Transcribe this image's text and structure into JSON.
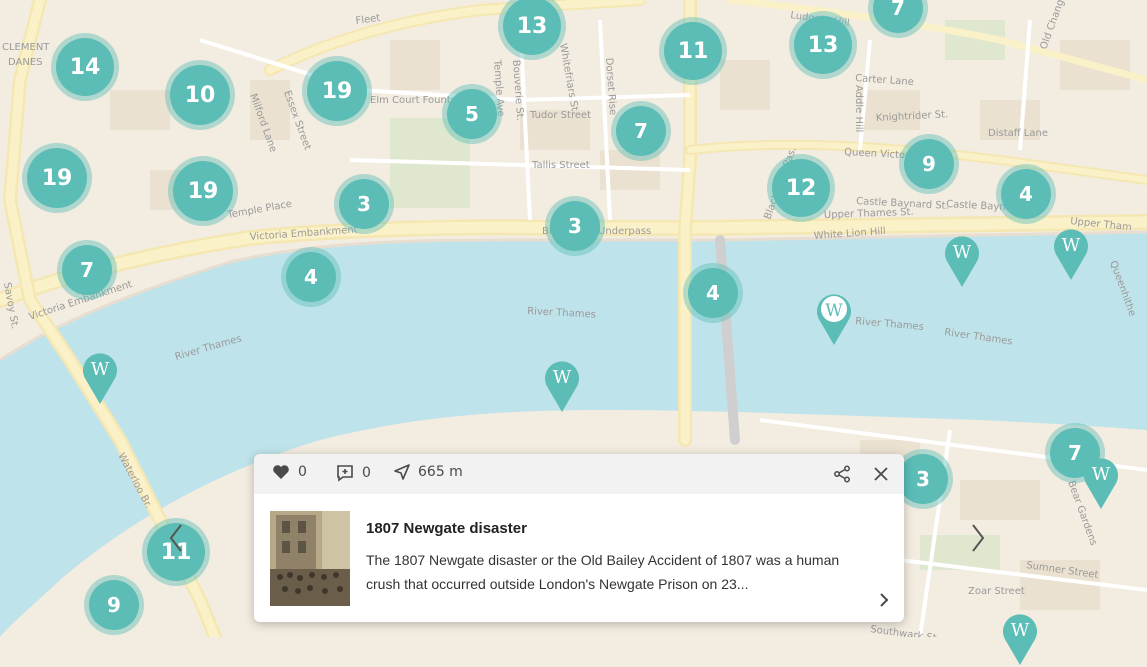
{
  "map": {
    "street_labels": [
      "CLEMENT",
      "DANES",
      "Fleet",
      "Ludgate Hill",
      "Carter Lane",
      "Addle Hill",
      "Knightrider St.",
      "Distaff Lane",
      "Queen Victoria",
      "Castle Baynard St.",
      "Castle Baynard St.",
      "Upper Thames St.",
      "Upper Tham",
      "White Lion Hill",
      "Blackfriars Pas.",
      "Blackfriars Underpass",
      "Tudor Street",
      "Tallis Street",
      "Temple Place",
      "Victoria Embankment",
      "Victoria Embankment",
      "Elm Court Fountain",
      "River Thames",
      "River Thames",
      "River Thames",
      "River Thames",
      "Waterloo Br.",
      "Savoy St.",
      "Milford Lane",
      "Essex Street",
      "Dorset Rise",
      "Temple Ave",
      "Bouverie St.",
      "Whitefriars St.",
      "Sumner Street",
      "Zoar Street",
      "Bear Gardens",
      "Queenhithe",
      "Old Change",
      "Southwark St."
    ],
    "clusters": [
      "14",
      "10",
      "19",
      "19",
      "19",
      "3",
      "5",
      "13",
      "11",
      "13",
      "7",
      "7",
      "12",
      "9",
      "4",
      "3",
      "4",
      "4",
      "7",
      "3",
      "7",
      "9",
      "11"
    ],
    "wiki_marker_icon": "wikipedia-w-icon"
  },
  "card": {
    "likes": "0",
    "comments": "0",
    "distance": "665 m",
    "title": "1807 Newgate disaster",
    "description": "The 1807 Newgate disaster or the Old Bailey Accident of 1807 was a human crush that occurred outside London's Newgate Prison on 23...",
    "icons": {
      "like": "heart-icon",
      "comment": "comment-plus-icon",
      "distance": "navigation-arrow-icon",
      "share": "share-icon",
      "close": "close-icon",
      "more": "chevron-right-icon"
    }
  },
  "colors": {
    "accent": "#5bbdb6",
    "water": "#bfe3ea",
    "land": "#f3ece0",
    "road": "#fbe9a6"
  }
}
